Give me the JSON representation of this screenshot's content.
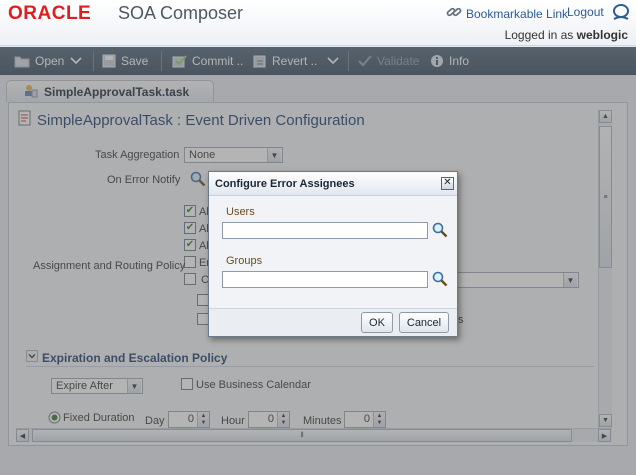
{
  "header": {
    "brand": "ORACLE",
    "app_title": "SOA Composer",
    "bookmarkable_link": "Bookmarkable Link",
    "logout": "Logout",
    "logged_in_prefix": "Logged in as",
    "username": "weblogic"
  },
  "toolbar": {
    "open": "Open",
    "save": "Save",
    "commit": "Commit ..",
    "revert": "Revert ..",
    "validate": "Validate",
    "info": "Info"
  },
  "tab": {
    "label": "SimpleApprovalTask.task"
  },
  "main": {
    "title": "SimpleApprovalTask : Event Driven Configuration",
    "task_aggregation_label": "Task Aggregation",
    "task_aggregation_value": "None",
    "on_error_notify_label": "On Error Notify",
    "assignment_routing_label": "Assignment and Routing Policy",
    "checkbox_fragments": [
      "Al",
      "Al",
      "Al",
      "Er",
      "C"
    ],
    "partial_text_right": "s",
    "section_title": "Expiration and Escalation Policy",
    "expire_select_value": "Expire After",
    "use_business_calendar": "Use Business Calendar",
    "fixed_duration": "Fixed Duration",
    "day_label": "Day",
    "day_value": "0",
    "hour_label": "Hour",
    "hour_value": "0",
    "minutes_label": "Minutes",
    "minutes_value": "0"
  },
  "dialog": {
    "title": "Configure Error Assignees",
    "users_label": "Users",
    "users_value": "",
    "groups_label": "Groups",
    "groups_value": "",
    "ok": "OK",
    "cancel": "Cancel"
  },
  "colors": {
    "oracle_red": "#e01e1e",
    "toolbar_bg": "#3f5367",
    "link": "#2e5b96",
    "title_blue": "#1b3e6d"
  }
}
